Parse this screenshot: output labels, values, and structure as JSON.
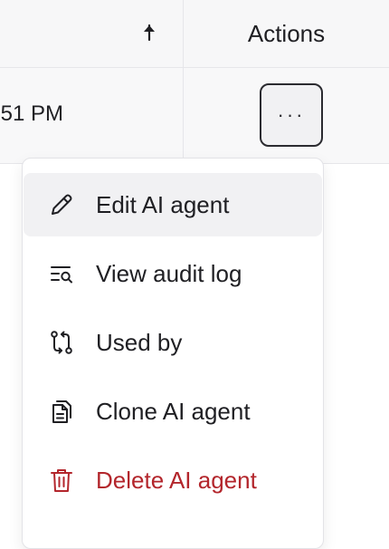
{
  "table": {
    "actions_header": "Actions",
    "row": {
      "time_fragment": ":51 PM",
      "more_button_label": "···"
    }
  },
  "menu": {
    "items": [
      {
        "label": "Edit AI agent",
        "icon": "pencil-icon"
      },
      {
        "label": "View audit log",
        "icon": "audit-log-icon"
      },
      {
        "label": "Used by",
        "icon": "used-by-icon"
      },
      {
        "label": "Clone AI agent",
        "icon": "clone-icon"
      },
      {
        "label": "Delete AI agent",
        "icon": "trash-icon"
      }
    ]
  },
  "colors": {
    "danger": "#b3262c",
    "active_item_bg": "#f1f1f3",
    "border": "#e6e6ea"
  }
}
